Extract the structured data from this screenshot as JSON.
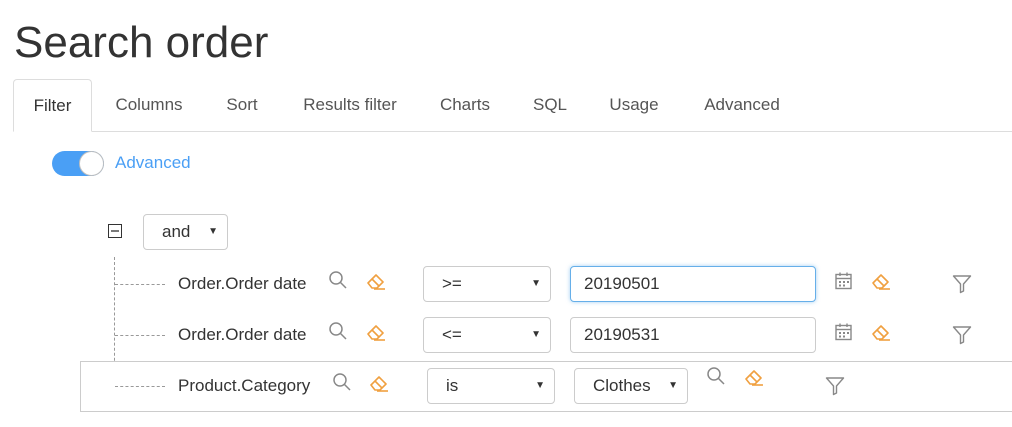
{
  "page": {
    "title": "Search order"
  },
  "tabs": [
    {
      "label": "Filter",
      "active": true
    },
    {
      "label": "Columns"
    },
    {
      "label": "Sort"
    },
    {
      "label": "Results filter"
    },
    {
      "label": "Charts"
    },
    {
      "label": "SQL"
    },
    {
      "label": "Usage"
    },
    {
      "label": "Advanced"
    }
  ],
  "advanced_toggle": {
    "label": "Advanced",
    "on": true
  },
  "group": {
    "operator": "and"
  },
  "conditions": [
    {
      "field": "Order.Order date",
      "operator": ">=",
      "value": "20190501"
    },
    {
      "field": "Order.Order date",
      "operator": "<=",
      "value": "20190531"
    },
    {
      "field": "Product.Category",
      "operator": "is",
      "value": "Clothes"
    }
  ],
  "colors": {
    "accent": "#4a9ff5",
    "eraser": "#f0a040",
    "icon_gray": "#888888",
    "border": "#cccccc"
  },
  "icons": {
    "collapse": "minus-square-icon",
    "lookup": "search-icon",
    "clear": "eraser-icon",
    "calendar": "calendar-icon",
    "filter": "filter-icon",
    "dropdown": "caret-down-icon"
  }
}
